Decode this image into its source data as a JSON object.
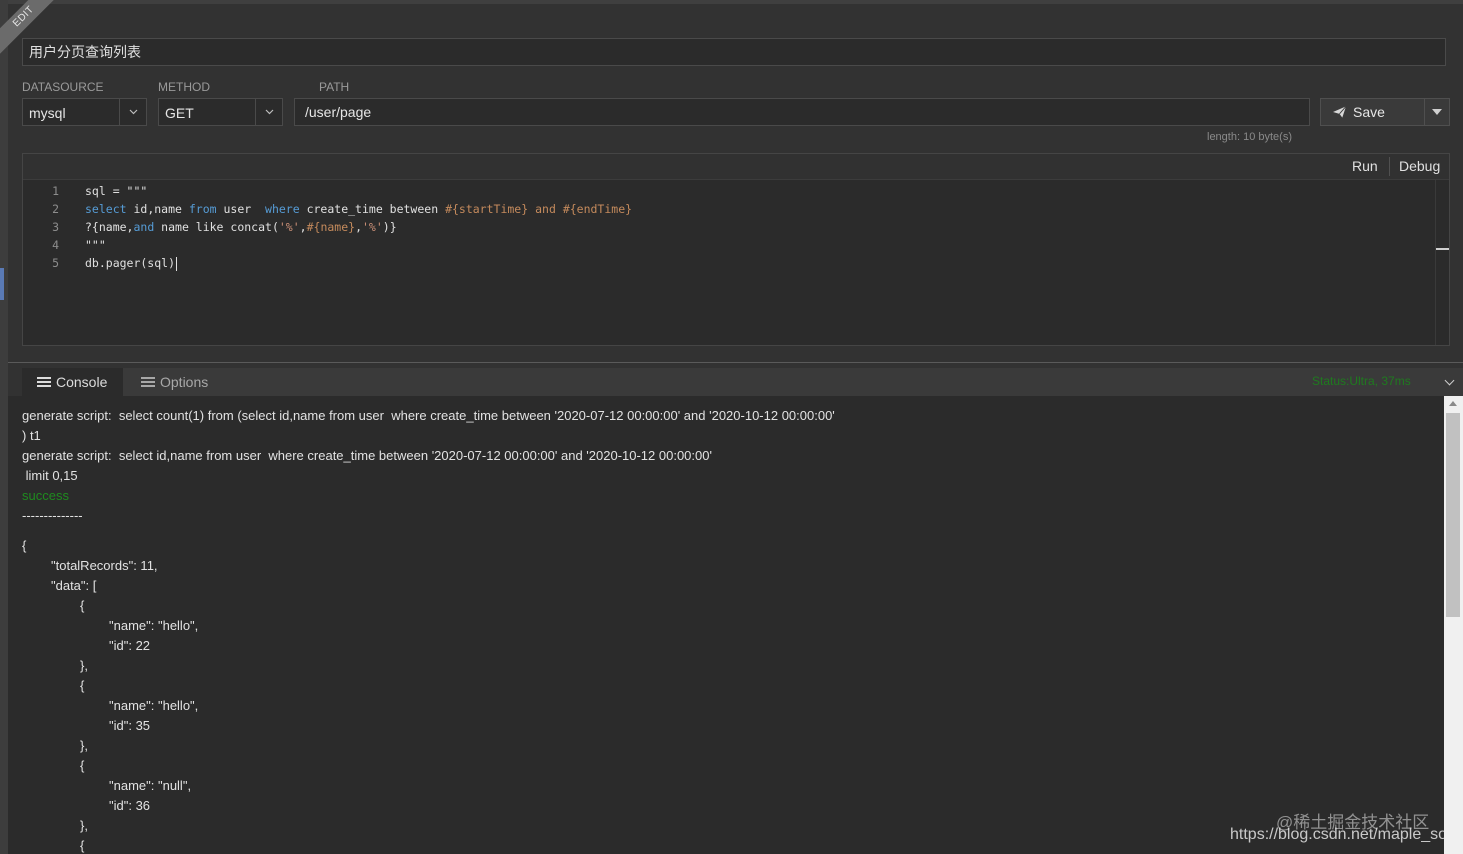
{
  "ribbon": "EDIT",
  "api_name": "用户分页查询列表",
  "labels": {
    "datasource": "DATASOURCE",
    "method": "METHOD",
    "path": "PATH"
  },
  "datasource": {
    "value": "mysql"
  },
  "method": {
    "value": "GET"
  },
  "path": {
    "value": "/user/page",
    "length": "length: 10 byte(s)"
  },
  "save": {
    "label": "Save"
  },
  "editor": {
    "run_label": "Run",
    "debug_label": "Debug",
    "line_numbers": [
      "1",
      "2",
      "3",
      "4",
      "5"
    ],
    "lines": [
      [
        {
          "t": "sql = \"\"\"",
          "c": ""
        }
      ],
      [
        {
          "t": "select",
          "c": "kw"
        },
        {
          "t": " id,name ",
          "c": ""
        },
        {
          "t": "from",
          "c": "kw"
        },
        {
          "t": " user  ",
          "c": ""
        },
        {
          "t": "where",
          "c": "kw"
        },
        {
          "t": " create_time between ",
          "c": ""
        },
        {
          "t": "#{startTime}",
          "c": "ph"
        },
        {
          "t": " ",
          "c": ""
        },
        {
          "t": "and",
          "c": "ph"
        },
        {
          "t": " ",
          "c": ""
        },
        {
          "t": "#{endTime}",
          "c": "ph"
        }
      ],
      [
        {
          "t": "?{name,",
          "c": ""
        },
        {
          "t": "and",
          "c": "kw"
        },
        {
          "t": " name like concat(",
          "c": ""
        },
        {
          "t": "'%'",
          "c": "str"
        },
        {
          "t": ",",
          "c": ""
        },
        {
          "t": "#{name}",
          "c": "ph"
        },
        {
          "t": ",",
          "c": ""
        },
        {
          "t": "'%'",
          "c": "str"
        },
        {
          "t": ")}",
          "c": ""
        }
      ],
      [
        {
          "t": "\"\"\"",
          "c": ""
        }
      ],
      [
        {
          "t": "db.pager(sql)",
          "c": ""
        }
      ]
    ]
  },
  "console": {
    "tabs": {
      "console": "Console",
      "options": "Options"
    },
    "status": "Status:Ultra, 37ms",
    "lines": [
      {
        "text": "generate script:  select count(1) from (select id,name from user  where create_time between '2020-07-12 00:00:00' and '2020-10-12 00:00:00'",
        "cls": "",
        "indent": 0
      },
      {
        "text": ") t1",
        "cls": "",
        "indent": 0
      },
      {
        "text": "generate script:  select id,name from user  where create_time between '2020-07-12 00:00:00' and '2020-10-12 00:00:00'",
        "cls": "",
        "indent": 0
      },
      {
        "text": " limit 0,15",
        "cls": "",
        "indent": 0
      },
      {
        "text": "success",
        "cls": "ok",
        "indent": 0
      },
      {
        "text": "--------------",
        "cls": "",
        "indent": 0
      },
      {
        "text": "{",
        "cls": "",
        "indent": 0,
        "gap": true
      },
      {
        "text": "\"totalRecords\": 11,",
        "cls": "",
        "indent": 1
      },
      {
        "text": "\"data\": [",
        "cls": "",
        "indent": 1
      },
      {
        "text": "{",
        "cls": "",
        "indent": 2
      },
      {
        "text": "\"name\": \"hello\",",
        "cls": "",
        "indent": 3
      },
      {
        "text": "\"id\": 22",
        "cls": "",
        "indent": 3
      },
      {
        "text": "},",
        "cls": "",
        "indent": 2
      },
      {
        "text": "{",
        "cls": "",
        "indent": 2
      },
      {
        "text": "\"name\": \"hello\",",
        "cls": "",
        "indent": 3
      },
      {
        "text": "\"id\": 35",
        "cls": "",
        "indent": 3
      },
      {
        "text": "},",
        "cls": "",
        "indent": 2
      },
      {
        "text": "{",
        "cls": "",
        "indent": 2
      },
      {
        "text": "\"name\": \"null\",",
        "cls": "",
        "indent": 3
      },
      {
        "text": "\"id\": 36",
        "cls": "",
        "indent": 3
      },
      {
        "text": "},",
        "cls": "",
        "indent": 2
      },
      {
        "text": "{",
        "cls": "",
        "indent": 2
      }
    ]
  },
  "watermark": {
    "line1": "@稀土掘金技术社区",
    "line2": "https://blog.csdn.net/maple_son"
  },
  "icons": {
    "save": "paper-plane-icon",
    "tab": "list-icon",
    "dropdown": "chevron-down-icon"
  }
}
